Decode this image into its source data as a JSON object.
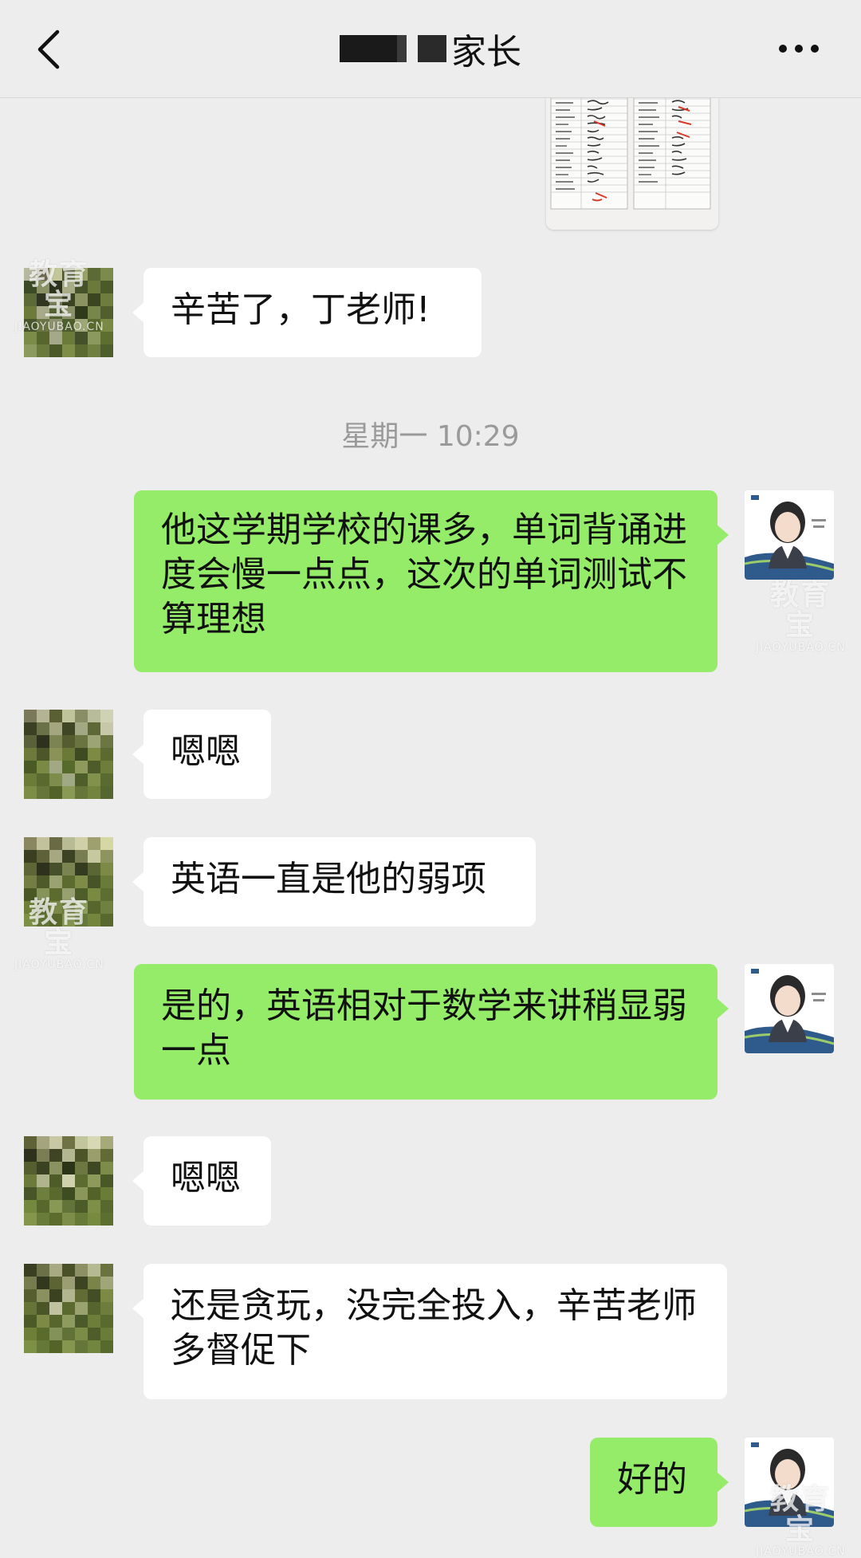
{
  "header": {
    "title": "家长",
    "back_icon": "chevron-left-icon",
    "more_icon": "more-horizontal-icon"
  },
  "messages": [
    {
      "side": "in",
      "text": "辛苦了，丁老师!"
    },
    {
      "side": "out",
      "text": "他这学期学校的课多，单词背诵进度会慢一点点，这次的单词测试不算理想"
    },
    {
      "side": "in",
      "text": "嗯嗯"
    },
    {
      "side": "in",
      "text": "英语一直是他的弱项"
    },
    {
      "side": "out",
      "text": "是的，英语相对于数学来讲稍显弱一点"
    },
    {
      "side": "in",
      "text": "嗯嗯"
    },
    {
      "side": "in",
      "text": "还是贪玩，没完全投入，辛苦老师多督促下"
    },
    {
      "side": "out",
      "text": "好的"
    }
  ],
  "timestamp": "星期一 10:29",
  "watermark": {
    "cn": "教育宝",
    "en": "JIAOYUBAO.CN"
  },
  "colors": {
    "background": "#ededed",
    "incoming_bubble": "#ffffff",
    "outgoing_bubble": "#95ec69",
    "timestamp": "#9a9a9a"
  }
}
